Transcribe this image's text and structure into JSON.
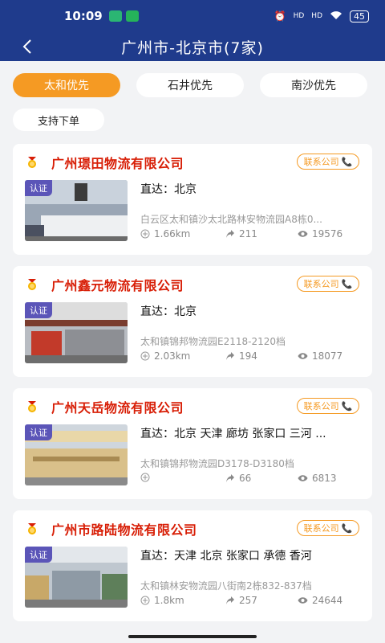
{
  "status_bar": {
    "time": "10:09",
    "battery": "45",
    "signal_1": "HD",
    "signal_2": "HD"
  },
  "header": {
    "title": "广州市-北京市(7家)"
  },
  "tabs": [
    {
      "label": "太和优先",
      "active": true
    },
    {
      "label": "石井优先",
      "active": false
    },
    {
      "label": "南沙优先",
      "active": false
    }
  ],
  "filter": {
    "label": "支持下单"
  },
  "colors": {
    "header": "#1f3b8c",
    "accent": "#f59a23",
    "company_name": "#d81e06",
    "cert": "#5b55b8"
  },
  "companies": [
    {
      "name": "广州璟田物流有限公司",
      "contact": "联系公司",
      "cert": "认证",
      "route": "直达：北京",
      "address": "白云区太和镇沙太北路林安物流园A8栋0...",
      "distance": "1.66km",
      "shares": "211",
      "views": "19576"
    },
    {
      "name": "广州鑫元物流有限公司",
      "contact": "联系公司",
      "cert": "认证",
      "route": "直达：北京",
      "address": "太和镇锦邦物流园E2118-2120档",
      "distance": "2.03km",
      "shares": "194",
      "views": "18077"
    },
    {
      "name": "广州天岳物流有限公司",
      "contact": "联系公司",
      "cert": "认证",
      "route": "直达：北京 天津 廊坊 张家口 三河 ...",
      "address": "太和镇锦邦物流园D3178-D3180档",
      "distance": "",
      "shares": "66",
      "views": "6813"
    },
    {
      "name": "广州市路陆物流有限公司",
      "contact": "联系公司",
      "cert": "认证",
      "route": "直达：天津 北京 张家口 承德 香河",
      "address": "太和镇林安物流园八街南2栋832-837档",
      "distance": "1.8km",
      "shares": "257",
      "views": "24644"
    }
  ]
}
